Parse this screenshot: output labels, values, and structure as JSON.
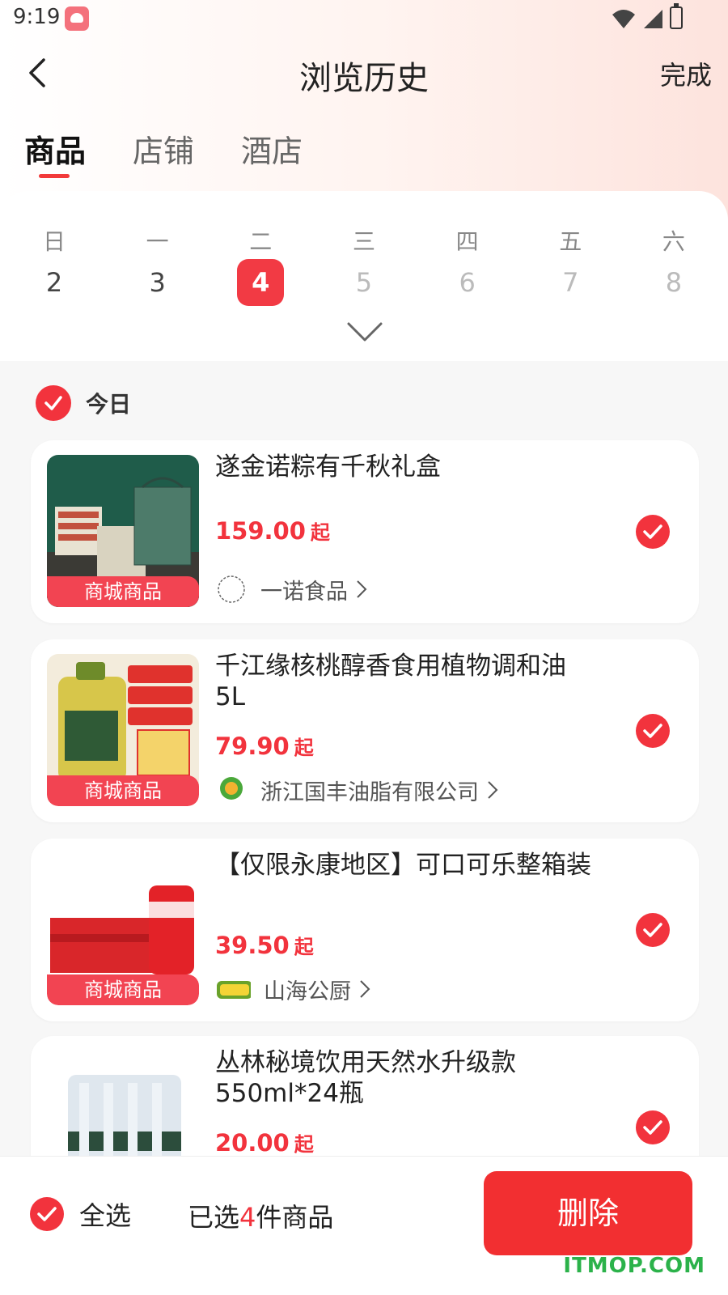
{
  "status_bar": {
    "time": "9:19"
  },
  "header": {
    "title": "浏览历史",
    "done_label": "完成"
  },
  "tabs": [
    {
      "label": "商品",
      "active": true
    },
    {
      "label": "店铺",
      "active": false
    },
    {
      "label": "酒店",
      "active": false
    }
  ],
  "calendar": {
    "weekdays": [
      "日",
      "一",
      "二",
      "三",
      "四",
      "五",
      "六"
    ],
    "dates": [
      "2",
      "3",
      "4",
      "5",
      "6",
      "7",
      "8"
    ],
    "selected_date": "4"
  },
  "group": {
    "label": "今日",
    "checked": true
  },
  "products": [
    {
      "title": "遂金诺粽有千秋礼盒",
      "price": "159.00",
      "price_suffix": "起",
      "badge": "商城商品",
      "store": "一诺食品",
      "checked": true
    },
    {
      "title": "千江缘核桃醇香食用植物调和油5L",
      "price": "79.90",
      "price_suffix": "起",
      "badge": "商城商品",
      "store": "浙江国丰油脂有限公司",
      "checked": true
    },
    {
      "title": "【仅限永康地区】可口可乐整箱装",
      "price": "39.50",
      "price_suffix": "起",
      "badge": "商城商品",
      "store": "山海公厨",
      "checked": true
    },
    {
      "title": "丛林秘境饮用天然水升级款550ml*24瓶",
      "price": "20.00",
      "price_suffix": "起",
      "checked": true
    }
  ],
  "bottom_bar": {
    "select_all_label": "全选",
    "selected_prefix": "已选",
    "selected_count": "4",
    "selected_suffix": "件商品",
    "delete_label": "删除"
  },
  "watermark": "ITMOP.COM",
  "colors": {
    "accent": "#f2333d",
    "badge": "#f24452",
    "delete": "#f22f31"
  }
}
